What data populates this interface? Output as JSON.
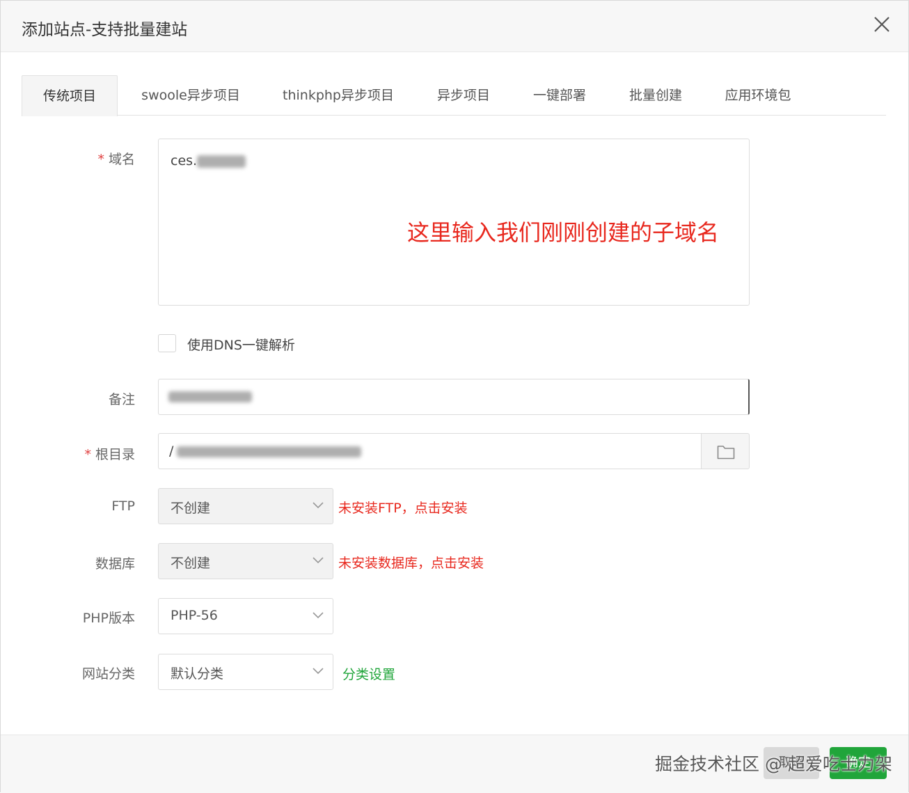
{
  "dialog": {
    "title": "添加站点-支持批量建站"
  },
  "tabs": [
    {
      "label": "传统项目",
      "active": true
    },
    {
      "label": "swoole异步项目"
    },
    {
      "label": "thinkphp异步项目"
    },
    {
      "label": "异步项目"
    },
    {
      "label": "一键部署"
    },
    {
      "label": "批量创建"
    },
    {
      "label": "应用环境包"
    }
  ],
  "form": {
    "required_mark": "*",
    "domain": {
      "label": "域名",
      "value_prefix": "ces."
    },
    "annotation": "这里输入我们刚刚创建的子域名",
    "dns": {
      "label": "使用DNS一键解析",
      "checked": false
    },
    "remark": {
      "label": "备注"
    },
    "root": {
      "label": "根目录",
      "value_prefix": "/"
    },
    "ftp": {
      "label": "FTP",
      "value": "不创建",
      "hint": "未安装FTP，点击安装"
    },
    "database": {
      "label": "数据库",
      "value": "不创建",
      "hint": "未安装数据库，点击安装"
    },
    "php": {
      "label": "PHP版本",
      "value": "PHP-56"
    },
    "category": {
      "label": "网站分类",
      "value": "默认分类",
      "link": "分类设置"
    }
  },
  "footer": {
    "cancel_label": "取消",
    "confirm_label": "确定"
  },
  "watermark": "掘金技术社区 @ 超爱吃士力架",
  "colors": {
    "accent_green": "#20a53a",
    "warning_red": "#e8281e"
  }
}
